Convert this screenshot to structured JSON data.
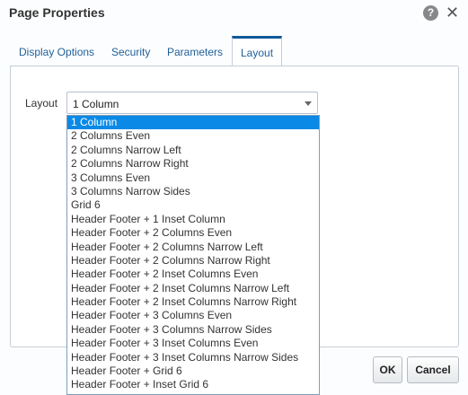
{
  "dialog": {
    "title": "Page Properties",
    "help_icon": "question-icon",
    "close_icon": "close-icon"
  },
  "tabs": [
    {
      "label": "Display Options",
      "active": false
    },
    {
      "label": "Security",
      "active": false
    },
    {
      "label": "Parameters",
      "active": false
    },
    {
      "label": "Layout",
      "active": true
    }
  ],
  "layout_field": {
    "label": "Layout",
    "value": "1 Column"
  },
  "dropdown": {
    "options": [
      "1 Column",
      "2 Columns Even",
      "2 Columns Narrow Left",
      "2 Columns Narrow Right",
      "3 Columns Even",
      "3 Columns Narrow Sides",
      "Grid 6",
      "Header Footer + 1 Inset Column",
      "Header Footer + 2 Columns Even",
      "Header Footer + 2 Columns Narrow Left",
      "Header Footer + 2 Columns Narrow Right",
      "Header Footer + 2 Inset Columns Even",
      "Header Footer + 2 Inset Columns Narrow Left",
      "Header Footer + 2 Inset Columns Narrow Right",
      "Header Footer + 3 Columns Even",
      "Header Footer + 3 Columns Narrow Sides",
      "Header Footer + 3 Inset Columns Even",
      "Header Footer + 3 Inset Columns Narrow Sides",
      "Header Footer + Grid 6",
      "Header Footer + Inset Grid 6"
    ],
    "selected": "1 Column",
    "highlight_color": "#0a8ae6"
  },
  "buttons": {
    "ok_label": "OK",
    "cancel_label": "Cancel"
  },
  "colors": {
    "accent": "#0e5a99",
    "tab_text": "#1f5f9a"
  }
}
